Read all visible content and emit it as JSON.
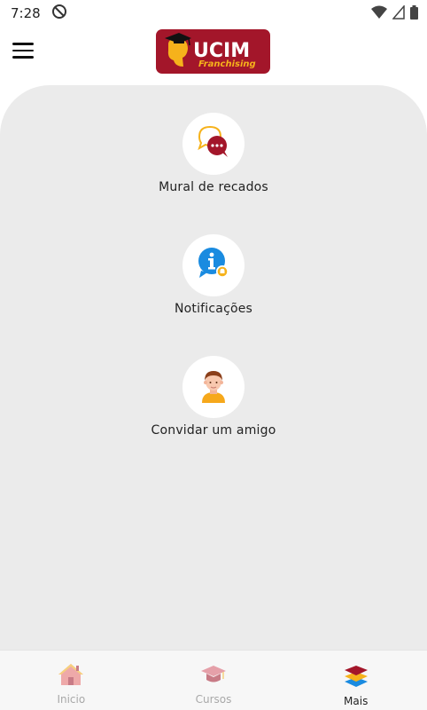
{
  "status_bar": {
    "time": "7:28"
  },
  "header": {
    "logo_title": "UCIM",
    "logo_subtitle": "Franchising"
  },
  "menu": [
    {
      "label": "Mural de recados",
      "icon": "chat-bubbles-icon"
    },
    {
      "label": "Notificações",
      "icon": "info-bell-icon"
    },
    {
      "label": "Convidar um amigo",
      "icon": "user-avatar-icon"
    }
  ],
  "bottom_nav": {
    "items": [
      {
        "label": "Inicio",
        "icon": "home-icon",
        "active": false
      },
      {
        "label": "Cursos",
        "icon": "graduation-cap-icon",
        "active": false
      },
      {
        "label": "Mais",
        "icon": "layers-icon",
        "active": true
      }
    ]
  },
  "colors": {
    "brand_red": "#a3162a",
    "brand_yellow": "#f6b21b",
    "content_bg": "#ebebeb",
    "info_blue": "#1a8be0"
  }
}
